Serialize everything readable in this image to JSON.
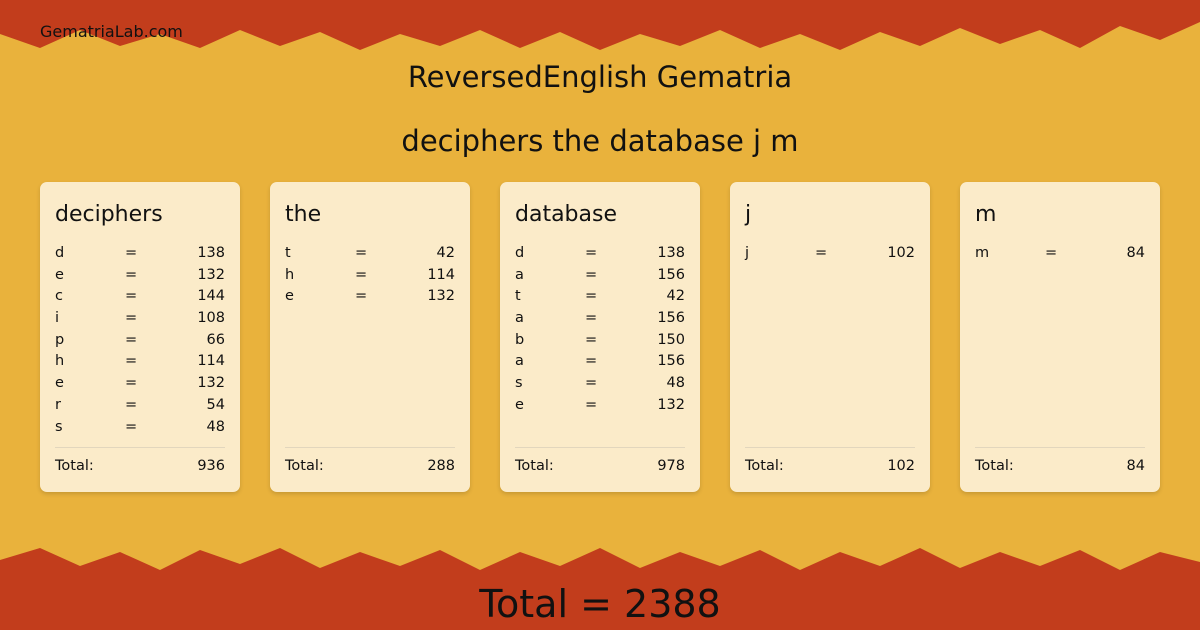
{
  "site": "GematriaLab.com",
  "title": "ReversedEnglish Gematria",
  "phrase": "deciphers the database j m",
  "total_label": "Total:",
  "grand_total": "Total = 2388",
  "colors": {
    "background": "#e9b23c",
    "border": "#c23d1c",
    "card": "#fbebc9"
  },
  "cards": [
    {
      "word": "deciphers",
      "total": "936",
      "rows": [
        {
          "l": "d",
          "eq": "=",
          "v": "138"
        },
        {
          "l": "e",
          "eq": "=",
          "v": "132"
        },
        {
          "l": "c",
          "eq": "=",
          "v": "144"
        },
        {
          "l": "i",
          "eq": "=",
          "v": "108"
        },
        {
          "l": "p",
          "eq": "=",
          "v": "66"
        },
        {
          "l": "h",
          "eq": "=",
          "v": "114"
        },
        {
          "l": "e",
          "eq": "=",
          "v": "132"
        },
        {
          "l": "r",
          "eq": "=",
          "v": "54"
        },
        {
          "l": "s",
          "eq": "=",
          "v": "48"
        }
      ]
    },
    {
      "word": "the",
      "total": "288",
      "rows": [
        {
          "l": "t",
          "eq": "=",
          "v": "42"
        },
        {
          "l": "h",
          "eq": "=",
          "v": "114"
        },
        {
          "l": "e",
          "eq": "=",
          "v": "132"
        }
      ]
    },
    {
      "word": "database",
      "total": "978",
      "rows": [
        {
          "l": "d",
          "eq": "=",
          "v": "138"
        },
        {
          "l": "a",
          "eq": "=",
          "v": "156"
        },
        {
          "l": "t",
          "eq": "=",
          "v": "42"
        },
        {
          "l": "a",
          "eq": "=",
          "v": "156"
        },
        {
          "l": "b",
          "eq": "=",
          "v": "150"
        },
        {
          "l": "a",
          "eq": "=",
          "v": "156"
        },
        {
          "l": "s",
          "eq": "=",
          "v": "48"
        },
        {
          "l": "e",
          "eq": "=",
          "v": "132"
        }
      ]
    },
    {
      "word": "j",
      "total": "102",
      "rows": [
        {
          "l": "j",
          "eq": "=",
          "v": "102"
        }
      ]
    },
    {
      "word": "m",
      "total": "84",
      "rows": [
        {
          "l": "m",
          "eq": "=",
          "v": "84"
        }
      ]
    }
  ]
}
